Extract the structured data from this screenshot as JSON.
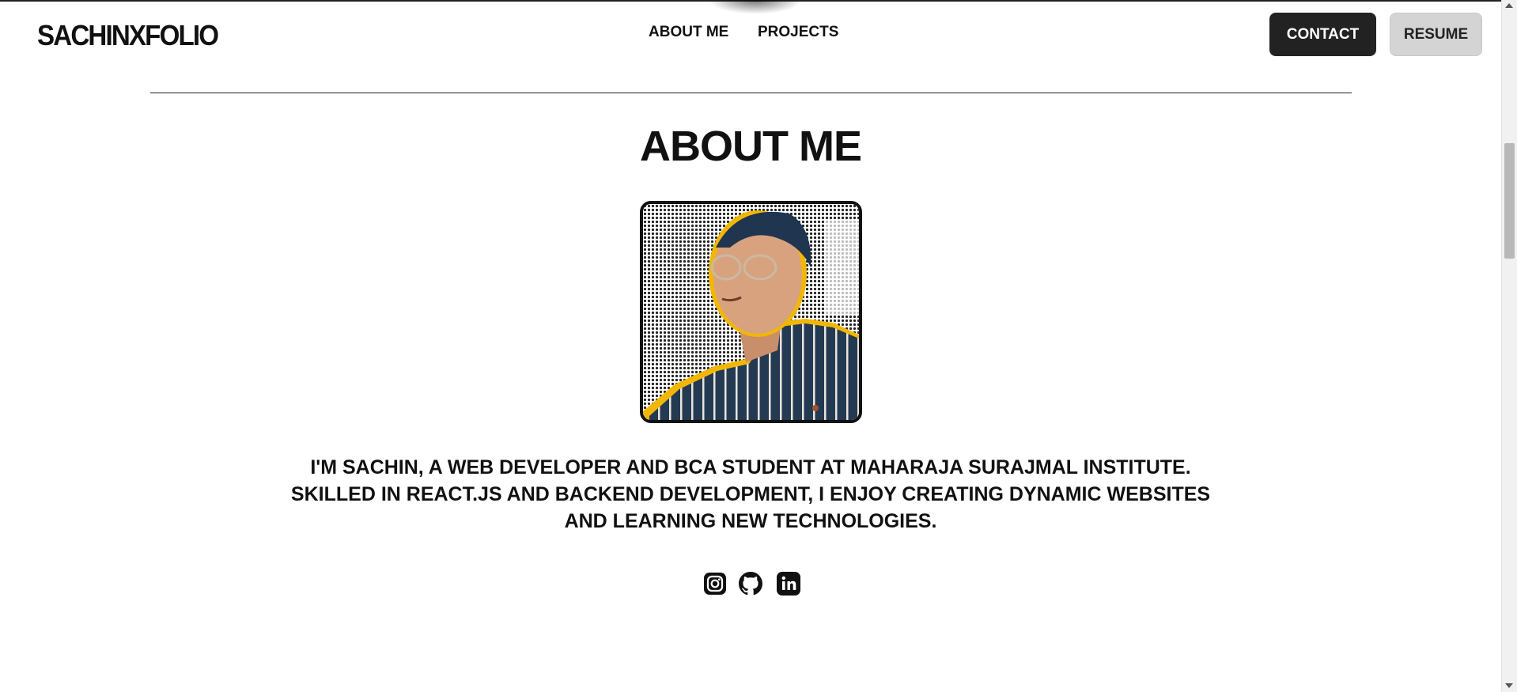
{
  "header": {
    "logo": "SACHINXFOLIO",
    "nav": [
      {
        "label": "ABOUT ME"
      },
      {
        "label": "PROJECTS"
      }
    ],
    "contact_label": "CONTACT",
    "resume_label": "RESUME"
  },
  "about": {
    "title": "ABOUT ME",
    "bio_lines": [
      "I'M SACHIN, A WEB DEVELOPER AND BCA STUDENT AT MAHARAJA SURAJMAL INSTITUTE.",
      "SKILLED IN REACT.JS AND BACKEND DEVELOPMENT, I ENJOY CREATING DYNAMIC WEBSITES",
      "AND LEARNING NEW TECHNOLOGIES."
    ],
    "photo_icon": "profile-photo",
    "socials": [
      {
        "icon": "instagram-icon"
      },
      {
        "icon": "github-icon"
      },
      {
        "icon": "linkedin-icon"
      }
    ]
  },
  "colors": {
    "text": "#111111",
    "contact_bg": "#222222",
    "resume_bg": "#d4d4d4",
    "photo_outline": "#f2b705",
    "shirt": "#243a52"
  }
}
